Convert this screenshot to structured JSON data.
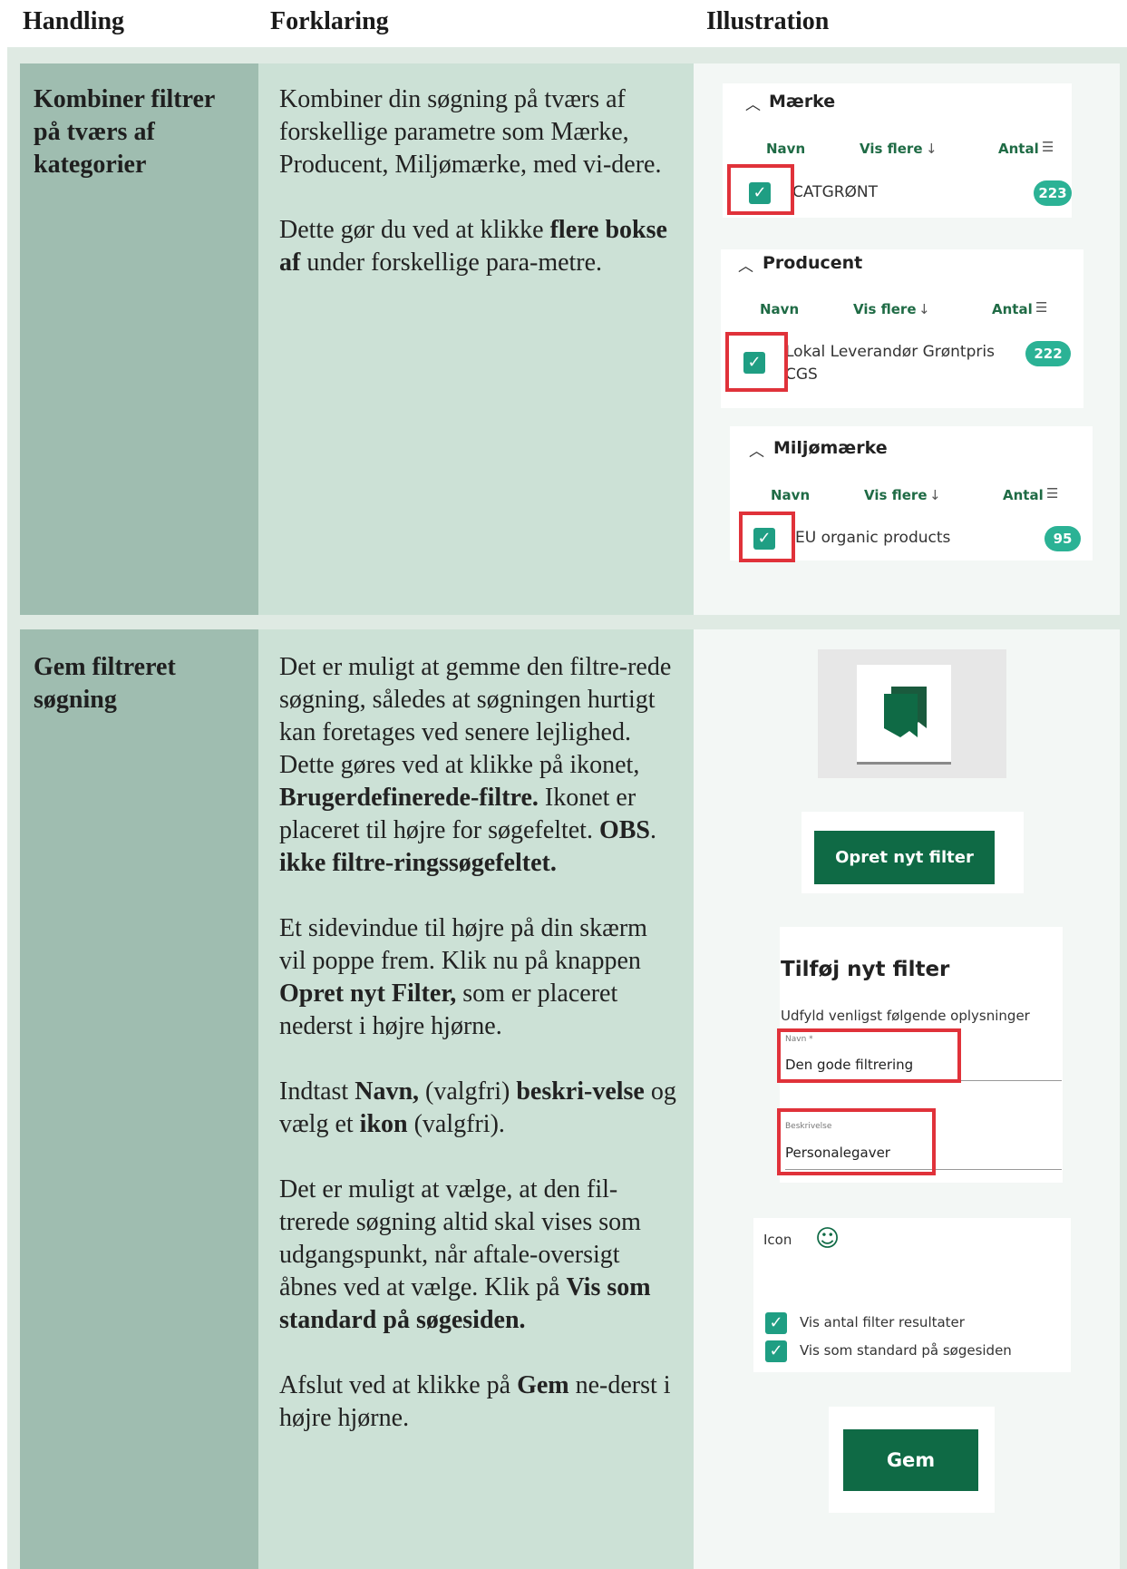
{
  "header": {
    "handling": "Handling",
    "forklaring": "Forklaring",
    "illustration": "Illustration"
  },
  "row1": {
    "action": "Kombiner filtrer på tværs af kategorier",
    "paragraphs": [
      {
        "parts": [
          {
            "t": "Kombiner din søgning på tværs af forskellige parametre som Mærke, Producent, Miljømærke, med vi-dere.",
            "b": false
          }
        ]
      },
      {
        "parts": [
          {
            "t": "Dette gør du ved at klikke ",
            "b": false
          },
          {
            "t": "flere bokse af",
            "b": true
          },
          {
            "t": " under forskellige para-metre.",
            "b": false
          }
        ]
      }
    ],
    "filters": [
      {
        "title": "Mærke",
        "col_name": "Navn",
        "col_more": "Vis flere",
        "col_count": "Antal",
        "item": "CATGRØNT",
        "count": "223"
      },
      {
        "title": "Producent",
        "col_name": "Navn",
        "col_more": "Vis flere",
        "col_count": "Antal",
        "item": "Lokal Leverandør Grøntpris CGS",
        "count": "222"
      },
      {
        "title": "Miljømærke",
        "col_name": "Navn",
        "col_more": "Vis flere",
        "col_count": "Antal",
        "item": "EU organic products",
        "count": "95"
      }
    ]
  },
  "row2": {
    "action": "Gem filtreret søgning",
    "paragraphs": [
      {
        "parts": [
          {
            "t": "Det er muligt at gemme den filtre-rede søgning, således at søgningen hurtigt kan foretages ved senere lejlighed. Dette gøres ved at klikke på ikonet, ",
            "b": false
          },
          {
            "t": "Brugerdefinerede-filtre.",
            "b": true
          },
          {
            "t": " Ikonet er placeret til højre for søgefeltet. ",
            "b": false
          },
          {
            "t": "OBS",
            "b": true
          },
          {
            "t": ". ",
            "b": false
          },
          {
            "t": "ikke filtre-ringssøgefeltet.",
            "b": true
          }
        ]
      },
      {
        "parts": [
          {
            "t": "Et sidevindue til højre på din skærm vil poppe frem. Klik nu på knappen ",
            "b": false
          },
          {
            "t": "Opret nyt Filter,",
            "b": true
          },
          {
            "t": " som er placeret nederst i højre hjørne.",
            "b": false
          }
        ]
      },
      {
        "parts": [
          {
            "t": "Indtast ",
            "b": false
          },
          {
            "t": "Navn,",
            "b": true
          },
          {
            "t": " (valgfri) ",
            "b": false
          },
          {
            "t": "beskri-velse",
            "b": true
          },
          {
            "t": " og vælg et ",
            "b": false
          },
          {
            "t": "ikon",
            "b": true
          },
          {
            "t": " (valgfri).",
            "b": false
          }
        ]
      },
      {
        "parts": [
          {
            "t": "Det er muligt at vælge, at den fil-trerede søgning altid skal vises som udgangspunkt, når aftale-oversigt åbnes ved at vælge. Klik på ",
            "b": false
          },
          {
            "t": "Vis som standard på søgesiden.",
            "b": true
          }
        ]
      },
      {
        "parts": [
          {
            "t": "Afslut ved at klikke på ",
            "b": false
          },
          {
            "t": "Gem",
            "b": true
          },
          {
            "t": " ne-derst i højre hjørne.",
            "b": false
          }
        ]
      }
    ],
    "create_button": "Opret nyt filter",
    "dialog": {
      "title": "Tilføj nyt filter",
      "subtitle": "Udfyld venligst følgende oplysninger",
      "name_label": "Navn *",
      "name_value": "Den gode filtrering",
      "desc_label": "Beskrivelse",
      "desc_value": "Personalegaver",
      "icon_label": "Icon",
      "check1": "Vis antal filter resultater",
      "check2": "Vis som standard på søgesiden"
    },
    "save_button": "Gem"
  },
  "colors": {
    "accent": "#0f6a45",
    "badge": "#2bb295",
    "highlight": "#e0323a"
  }
}
